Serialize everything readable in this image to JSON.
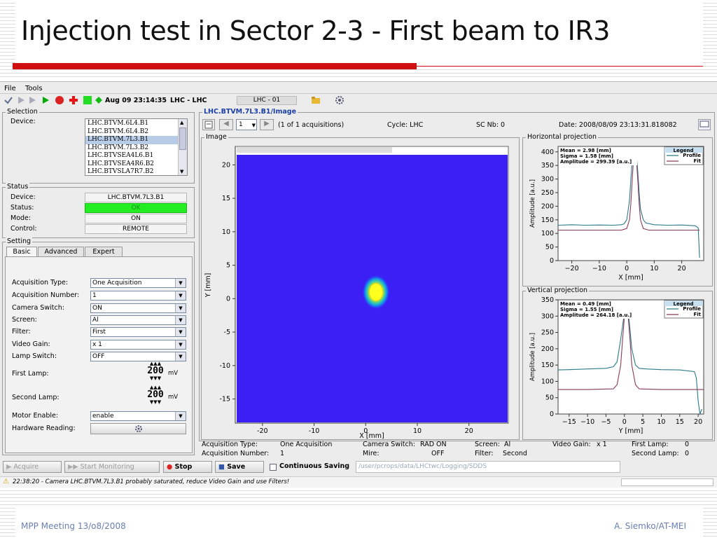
{
  "slide": {
    "title": "Injection test in Sector 2-3 - First beam to IR3",
    "footer_left": "MPP Meeting 13/o8/2008",
    "footer_right": "A. Siemko/AT-MEI"
  },
  "menu": {
    "file": "File",
    "tools": "Tools"
  },
  "toolbar": {
    "timestamp": "Aug 09 23:14:35",
    "context": "LHC - LHC",
    "cycle_field": "LHC - 01"
  },
  "selection": {
    "title": "Selection",
    "device_label": "Device:",
    "devices": [
      "LHC.BTVM.6L4.B1",
      "LHC.BTVM.6L4.B2",
      "LHC.BTVM.7L3.B1",
      "LHC.BTVM.7L3.B2",
      "LHC.BTVSEA4L6.B1",
      "LHC.BTVSEA4R6.B2",
      "LHC.BTVSLA7R7.B2"
    ],
    "selected_index": 2
  },
  "status": {
    "title": "Status",
    "device_label": "Device:",
    "device_value": "LHC.BTVM.7L3.B1",
    "status_label": "Status:",
    "status_value": "OK",
    "mode_label": "Mode:",
    "mode_value": "ON",
    "control_label": "Control:",
    "control_value": "REMOTE",
    "ok_color": "#22ee22"
  },
  "setting": {
    "title": "Setting",
    "tabs": [
      "Basic",
      "Advanced",
      "Expert"
    ],
    "acq_type_label": "Acquisition Type:",
    "acq_type_value": "One Acquisition",
    "acq_number_label": "Acquisition Number:",
    "acq_number_value": "1",
    "camera_label": "Camera Switch:",
    "camera_value": "ON",
    "screen_label": "Screen:",
    "screen_value": "Al",
    "filter_label": "Filter:",
    "filter_value": "First",
    "gain_label": "Video Gain:",
    "gain_value": "x 1",
    "lamp_label": "Lamp Switch:",
    "lamp_value": "OFF",
    "first_lamp_label": "First Lamp:",
    "first_lamp_value": "200",
    "first_lamp_unit": "mV",
    "second_lamp_label": "Second Lamp:",
    "second_lamp_value": "200",
    "second_lamp_unit": "mV",
    "motor_label": "Motor Enable:",
    "motor_value": "enable",
    "hw_label": "Hardware Reading:"
  },
  "image_panel": {
    "device_title": "LHC.BTVM.7L3.B1/Image",
    "page_value": "1",
    "acq_count": "(1 of 1 acquisitions)",
    "cycle": "Cycle: LHC",
    "sc_nb": "SC Nb: 0",
    "date": "Date:  2008/08/09 23:13:31.818082",
    "image_title": "Image",
    "xlabel": "X [mm]",
    "ylabel": "Y [mm]",
    "xticks": [
      "-20",
      "-10",
      "0",
      "10",
      "20"
    ],
    "yticks": [
      "20",
      "15",
      "10",
      "5",
      "0",
      "-5",
      "-10",
      "-15"
    ]
  },
  "info": {
    "acq_type": "Acquisition Type:",
    "acq_type_v": "One Acquisition",
    "acq_num": "Acquisition Number:",
    "acq_num_v": "1",
    "camera": "Camera Switch:",
    "camera_v": "RAD ON",
    "mire": "Mire:",
    "mire_v": "OFF",
    "screen": "Screen:",
    "screen_v": "Al",
    "filter": "Filter:",
    "filter_v": "Second",
    "gain": "Video Gain:",
    "gain_v": "x 1",
    "first_lamp": "First Lamp:",
    "first_lamp_v": "0",
    "second_lamp": "Second Lamp:",
    "second_lamp_v": "0"
  },
  "buttons": {
    "acquire": "Acquire",
    "start_monitoring": "Start Monitoring",
    "stop": "Stop",
    "save": "Save",
    "continuous_saving": "Continuous Saving",
    "path": "/user/pcrops/data/LHCtwc/Logging/SDDS"
  },
  "status_bar": {
    "message": "22:38:20 - Camera LHC.BTVM.7L3.B1 probably saturated, reduce Video Gain and use Filters!"
  },
  "chart_data": [
    {
      "type": "line",
      "title": "Horizontal projection",
      "xlabel": "X [mm]",
      "ylabel": "Amplitude [a.u.]",
      "xlim": [
        -25,
        28
      ],
      "ylim": [
        0,
        420
      ],
      "xticks": [
        -20,
        -10,
        0,
        10,
        20
      ],
      "yticks": [
        0,
        50,
        100,
        150,
        200,
        250,
        300,
        350,
        400
      ],
      "stats": [
        "Mean = 2.98 [mm]",
        "Sigma = 1.58 [mm]",
        "Amplitude = 299.39 [a.u.]"
      ],
      "legend_title": "Legend",
      "series": [
        {
          "name": "Profile",
          "color": "#2a7a8a",
          "x": [
            -25,
            -20,
            -15,
            -10,
            -5,
            -2,
            -1,
            0,
            1,
            1.5,
            2,
            2.5,
            3,
            3.5,
            4,
            4.5,
            5,
            6,
            7,
            10,
            15,
            20,
            25,
            26,
            26.5
          ],
          "y": [
            130,
            132,
            130,
            131,
            130,
            132,
            135,
            150,
            220,
            300,
            370,
            410,
            413,
            390,
            330,
            250,
            190,
            150,
            138,
            132,
            130,
            131,
            128,
            120,
            10
          ]
        },
        {
          "name": "Fit",
          "color": "#8a3a5a",
          "x": [
            -25,
            -10,
            -2,
            0,
            1,
            1.5,
            2,
            2.5,
            3,
            3.5,
            4,
            4.5,
            5,
            6,
            8,
            15,
            25,
            26.5
          ],
          "y": [
            112,
            112,
            112,
            118,
            150,
            210,
            300,
            380,
            411,
            380,
            300,
            210,
            150,
            118,
            112,
            112,
            112,
            112
          ]
        }
      ]
    },
    {
      "type": "line",
      "title": "Vertical projection",
      "xlabel": "Y [mm]",
      "ylabel": "Amplitude [a.u.]",
      "xlim": [
        -18,
        21.5
      ],
      "ylim": [
        0,
        350
      ],
      "xticks": [
        -15,
        -10,
        -5,
        0,
        5,
        10,
        15,
        20
      ],
      "yticks": [
        0,
        50,
        100,
        150,
        200,
        250,
        300,
        350
      ],
      "stats": [
        "Mean = 0.49 [mm]",
        "Sigma = 1.55 [mm]",
        "Amplitude = 264.18 [a.u.]"
      ],
      "legend_title": "Legend",
      "series": [
        {
          "name": "Profile",
          "color": "#2a7a8a",
          "x": [
            -18,
            -15,
            -10,
            -5,
            -3,
            -2,
            -1,
            0,
            0.5,
            1,
            1.5,
            2,
            3,
            4,
            6,
            10,
            15,
            19,
            19.5,
            20,
            20.5,
            21
          ],
          "y": [
            135,
            136,
            138,
            140,
            145,
            160,
            230,
            310,
            338,
            320,
            260,
            200,
            150,
            140,
            138,
            136,
            135,
            130,
            110,
            40,
            0,
            15
          ]
        },
        {
          "name": "Fit",
          "color": "#8a3a5a",
          "x": [
            -18,
            -10,
            -3,
            -2,
            -1,
            -0.5,
            0,
            0.5,
            1,
            1.5,
            2,
            3,
            4,
            10,
            21.5
          ],
          "y": [
            75,
            75,
            77,
            90,
            150,
            230,
            300,
            339,
            300,
            230,
            150,
            90,
            77,
            75,
            75
          ]
        }
      ]
    }
  ]
}
